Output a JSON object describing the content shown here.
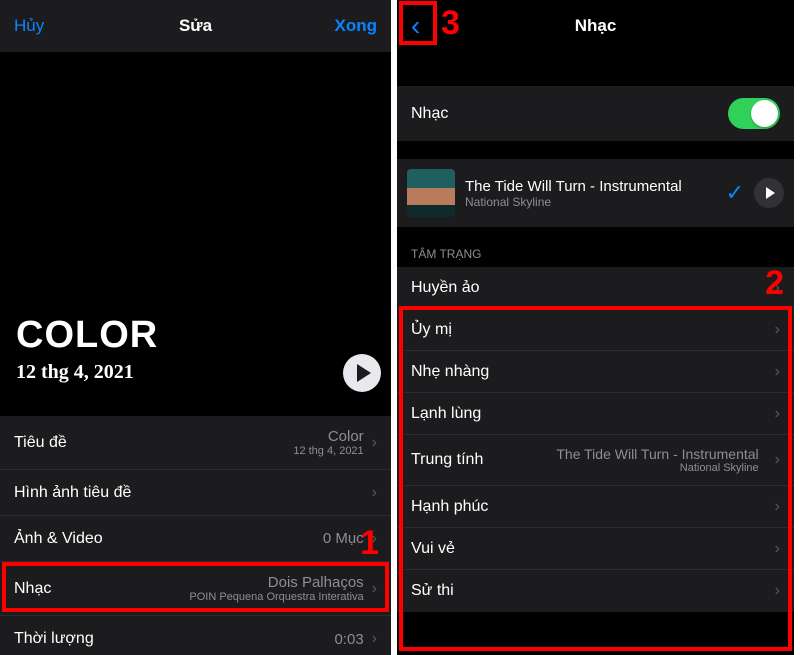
{
  "left": {
    "nav": {
      "cancel": "Hủy",
      "title": "Sửa",
      "done": "Xong"
    },
    "preview": {
      "title": "COLOR",
      "date": "12 thg 4, 2021"
    },
    "rows": {
      "title_label": "Tiêu đề",
      "title_value": "Color",
      "title_sub": "12 thg 4, 2021",
      "cover_label": "Hình ảnh tiêu đề",
      "media_label": "Ảnh & Video",
      "media_value": "0 Mục",
      "music_label": "Nhạc",
      "music_value": "Dois Palhaços",
      "music_sub": "POIN Pequena Orquestra Interativa",
      "duration_label": "Thời lượng",
      "duration_value": "0:03"
    }
  },
  "right": {
    "nav_title": "Nhạc",
    "toggle_label": "Nhạc",
    "track": {
      "title": "The Tide Will Turn - Instrumental",
      "artist": "National Skyline"
    },
    "section": "TÂM TRẠNG",
    "moods": [
      {
        "label": "Huyền ảo"
      },
      {
        "label": "Ủy mị"
      },
      {
        "label": "Nhẹ nhàng"
      },
      {
        "label": "Lạnh lùng"
      },
      {
        "label": "Trung tính",
        "detail_title": "The Tide Will Turn - Instrumental",
        "detail_artist": "National Skyline"
      },
      {
        "label": "Hạnh phúc"
      },
      {
        "label": "Vui vẻ"
      },
      {
        "label": "Sử thi"
      }
    ]
  },
  "annotations": {
    "n1": "1",
    "n2": "2",
    "n3": "3"
  }
}
